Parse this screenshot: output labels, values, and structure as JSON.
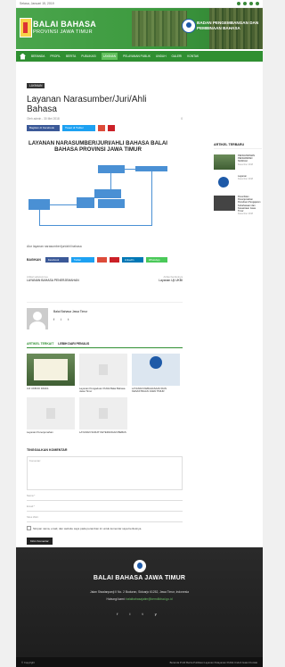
{
  "topbar": {
    "date": "Selasa, Januari 15, 2019"
  },
  "header": {
    "title": "BALAI BAHASA",
    "subtitle": "PROVINSI JAWA TIMUR",
    "badan": "BADAN PENGEMBANGAN DAN PEMBINAAN BAHASA"
  },
  "nav": {
    "items": [
      {
        "label": "BERANDA"
      },
      {
        "label": "PROFIL"
      },
      {
        "label": "BERITA"
      },
      {
        "label": "PUBLIKASI"
      },
      {
        "label": "LAYANAN"
      },
      {
        "label": "PELAYANAN PUBLIK"
      },
      {
        "label": "UNDUH"
      },
      {
        "label": "GALERI"
      },
      {
        "label": "KONTAK"
      }
    ]
  },
  "article": {
    "category": "LAYANAN",
    "title": "Layanan Narasumber/Juri/Ahli Bahasa",
    "author_date": "Oleh admin - 30 Mei 2018",
    "views": "0",
    "share_fb": "Bagikan di Facebook",
    "share_tw": "Tweet di Twitter",
    "flow_title": "LAYANAN NARASUMBER/JURI/AHLI BAHASA BALAI BAHASA PROVINSI JAWA TIMUR",
    "caption": "Alur layanan narasumber/juri/ahli bahasa",
    "share_label": "BAGIKAN",
    "share2": [
      "Facebook",
      "Twitter",
      "Google+",
      "Pinterest",
      "LinkedIn",
      "WhatsApp"
    ]
  },
  "prevnext": {
    "prev_label": "Artikel sebelumnya",
    "prev_title": "LAYANAN BAHASA PENERJEMAHAN",
    "next_label": "Artikel berikutnya",
    "next_title": "Layanan Uji UKBI"
  },
  "author": {
    "name": "Balai Bahasa Jawa Timur",
    "socials": "f i t"
  },
  "related": {
    "tab1": "ARTIKEL TERKAIT",
    "tab2": "LEBIH DARI PENULIS",
    "items": [
      {
        "caption": "UJI UKBI DI DINAS"
      },
      {
        "caption": "Layanan Pengaduan Publik Balai Bahasa Jawa Timur"
      },
      {
        "caption": "LAYANAN KEBAHASAAN DAN KESASTRAAN JAWA TIMUR"
      },
      {
        "caption": "Layanan Penerjemahan"
      },
      {
        "caption": "LAYANAN SURAT KETERANGAN BEBAS"
      }
    ]
  },
  "comment": {
    "heading": "TINGGALKAN KOMENTAR",
    "placeholder": "Komentar:",
    "name": "Nama:*",
    "email": "Email:*",
    "website": "Situs Web:",
    "remember": "Simpan nama, email, dan website saya pada peramban ini untuk komentar saya berikutnya.",
    "submit": "Kirim Komentar"
  },
  "sidebar": {
    "heading": "ARTIKEL TERBARU",
    "items": [
      {
        "title": "PENGUMUMAN PENGIRIMAN NASKAH",
        "date": "Desember 2018"
      },
      {
        "title": "Layanan",
        "date": "Desember 2018"
      },
      {
        "title": "Penerbitan Penerjemahan Penulisan Pengajaran Kebahasaan dan Kesastraan Jawa Timur",
        "date": "Desember 2018"
      }
    ]
  },
  "footer": {
    "name": "BALAI BAHASA JAWA TIMUR",
    "address": "Jalan Siwalanpanji II No. 2 Buduran, Sidoarjo 61252, Jawa Timur, Indonesia",
    "contact_prefix": "Hubungi kami:",
    "contact_email": "balaibahasajatim@kemdikbud.go.id",
    "socials": "f i t y"
  },
  "bottombar": {
    "copyright": "© Copyright",
    "links": "Beranda Profil Berita Publikasi Layanan Pelayanan Publik Unduh Galeri Kontak"
  }
}
